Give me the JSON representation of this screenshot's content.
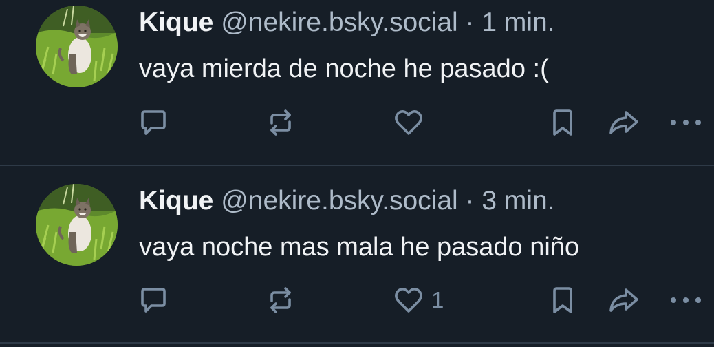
{
  "posts": [
    {
      "author_name": "Kique",
      "handle": "@nekire.bsky.social",
      "separator": "·",
      "time": "1 min.",
      "text": "vaya mierda de noche he pasado :(",
      "like_count": ""
    },
    {
      "author_name": "Kique",
      "handle": "@nekire.bsky.social",
      "separator": "·",
      "time": "3 min.",
      "text": "vaya noche mas mala he pasado niño",
      "like_count": "1"
    }
  ],
  "icons": {
    "reply": "reply-icon",
    "repost": "repost-icon",
    "like": "heart-icon",
    "bookmark": "bookmark-icon",
    "share": "share-icon",
    "more": "more-icon",
    "avatar": "cat-avatar"
  },
  "colors": {
    "background": "#161e27",
    "text_primary": "#f1f3f5",
    "text_secondary": "#aebbc9",
    "icon": "#7b8ea3",
    "divider": "#2e3a47"
  }
}
